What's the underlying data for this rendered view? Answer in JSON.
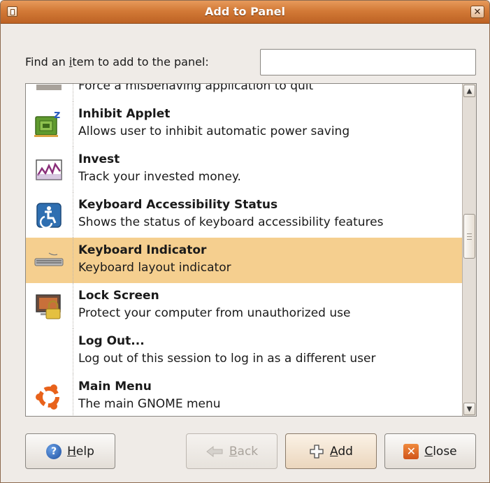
{
  "window": {
    "title": "Add to Panel",
    "menu_icon": "window-menu-icon",
    "close_glyph": "✕"
  },
  "search": {
    "label_pre": "Find an ",
    "label_mnemonic": "i",
    "label_post": "tem to add to the panel:",
    "value": "",
    "placeholder": ""
  },
  "list": {
    "partial_item_desc": "Force a misbehaving application to quit",
    "items": [
      {
        "name": "Inhibit Applet",
        "desc": "Allows user to inhibit automatic power saving",
        "icon": "inhibit-applet-icon"
      },
      {
        "name": "Invest",
        "desc": "Track your invested money.",
        "icon": "invest-chart-icon"
      },
      {
        "name": "Keyboard Accessibility Status",
        "desc": "Shows the status of keyboard accessibility features",
        "icon": "accessibility-icon"
      },
      {
        "name": "Keyboard Indicator",
        "desc": "Keyboard layout indicator",
        "icon": "keyboard-icon",
        "selected": true
      },
      {
        "name": "Lock Screen",
        "desc": "Protect your computer from unauthorized use",
        "icon": "lock-screen-icon"
      },
      {
        "name": "Log Out...",
        "desc": "Log out of this session to log in as a different user",
        "icon": ""
      },
      {
        "name": "Main Menu",
        "desc": "The main GNOME menu",
        "icon": "ubuntu-logo-icon"
      }
    ]
  },
  "scrollbar": {
    "up_glyph": "▲",
    "down_glyph": "▼"
  },
  "buttons": {
    "help": {
      "mnemonic": "H",
      "rest": "elp",
      "icon": "help-icon"
    },
    "back": {
      "mnemonic": "B",
      "rest": "ack",
      "icon": "back-arrow-icon",
      "disabled": true
    },
    "add": {
      "mnemonic": "A",
      "rest": "dd",
      "icon": "plus-icon"
    },
    "close": {
      "mnemonic": "C",
      "rest": "lose",
      "icon": "close-icon"
    }
  },
  "colors": {
    "titlebar": "#d37a37",
    "selection": "#f5cf8f",
    "window_bg": "#efebe7"
  }
}
